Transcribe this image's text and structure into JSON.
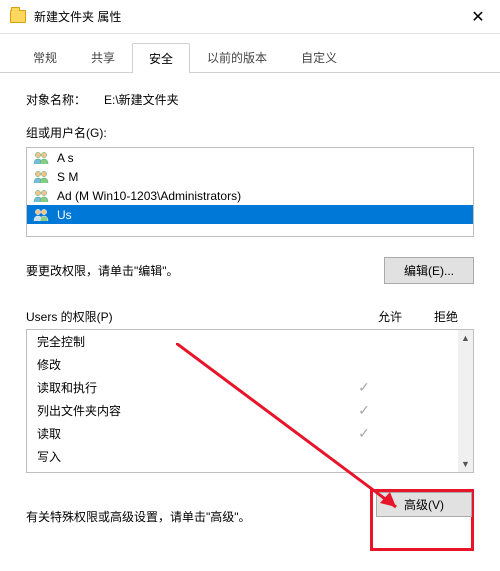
{
  "title": "新建文件夹 属性",
  "tabs": [
    "常规",
    "共享",
    "安全",
    "以前的版本",
    "自定义"
  ],
  "activeTab": 2,
  "objectLabel": "对象名称：",
  "objectValue": "E:\\新建文件夹",
  "groupLabel": "组或用户名(G):",
  "users": [
    {
      "name": "A                                    s",
      "selected": false
    },
    {
      "name": "S             M",
      "selected": false
    },
    {
      "name": "Ad                         (M       Win10-1203\\Administrators)",
      "selected": false
    },
    {
      "name": "Us                                                 ",
      "selected": true
    }
  ],
  "editHint": "要更改权限，请单击\"编辑\"。",
  "editBtn": "编辑(E)...",
  "permHeaderLabel": "Users 的权限(P)",
  "allowLabel": "允许",
  "denyLabel": "拒绝",
  "permissions": [
    {
      "name": "完全控制",
      "allow": false,
      "deny": false
    },
    {
      "name": "修改",
      "allow": false,
      "deny": false
    },
    {
      "name": "读取和执行",
      "allow": true,
      "deny": false
    },
    {
      "name": "列出文件夹内容",
      "allow": true,
      "deny": false
    },
    {
      "name": "读取",
      "allow": true,
      "deny": false
    },
    {
      "name": "写入",
      "allow": false,
      "deny": false
    }
  ],
  "specialHint": "有关特殊权限或高级设置，请单击\"高级\"。",
  "advancedBtn": "高级(V)",
  "checkmark": "✓"
}
